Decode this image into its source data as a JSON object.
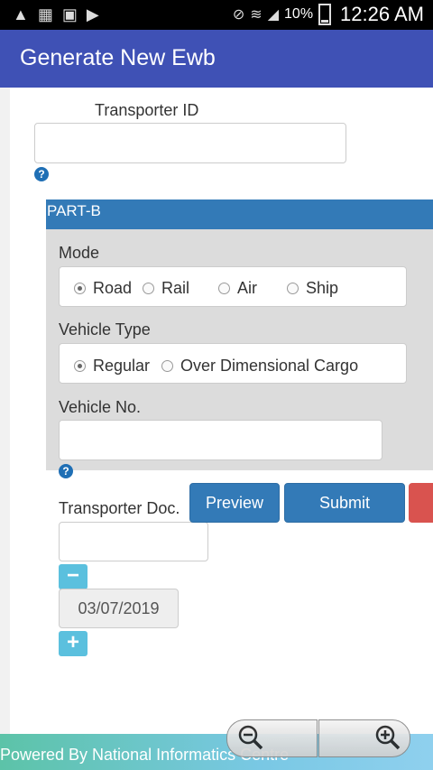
{
  "status_bar": {
    "battery": "10%",
    "time": "12:26 AM"
  },
  "app_bar": {
    "title": "Generate New Ewb"
  },
  "form": {
    "transporter_id": {
      "label": "Transporter ID",
      "value": "",
      "placeholder": ""
    },
    "help": "?",
    "part_b": {
      "header": "PART-B",
      "mode": {
        "label": "Mode",
        "options": [
          "Road",
          "Rail",
          "Air",
          "Ship"
        ],
        "selected": "Road"
      },
      "vehicle_type": {
        "label": "Vehicle Type",
        "options": [
          "Regular",
          "Over Dimensional Cargo"
        ],
        "selected": "Regular"
      },
      "vehicle_no": {
        "label": "Vehicle No.",
        "value": ""
      }
    },
    "transporter_doc": {
      "label": "Transporter Doc.",
      "value": "",
      "date": "03/07/2019",
      "minus": "−",
      "plus": "+"
    }
  },
  "actions": {
    "preview": "Preview",
    "submit": "Submit"
  },
  "footer": {
    "text": "Powered By National Informatics Centre"
  },
  "colors": {
    "app_bar": "#3f51b5",
    "part_b_header": "#337ab7",
    "button_primary": "#337ab7",
    "button_danger": "#d9534f",
    "button_info": "#5bc0de"
  }
}
